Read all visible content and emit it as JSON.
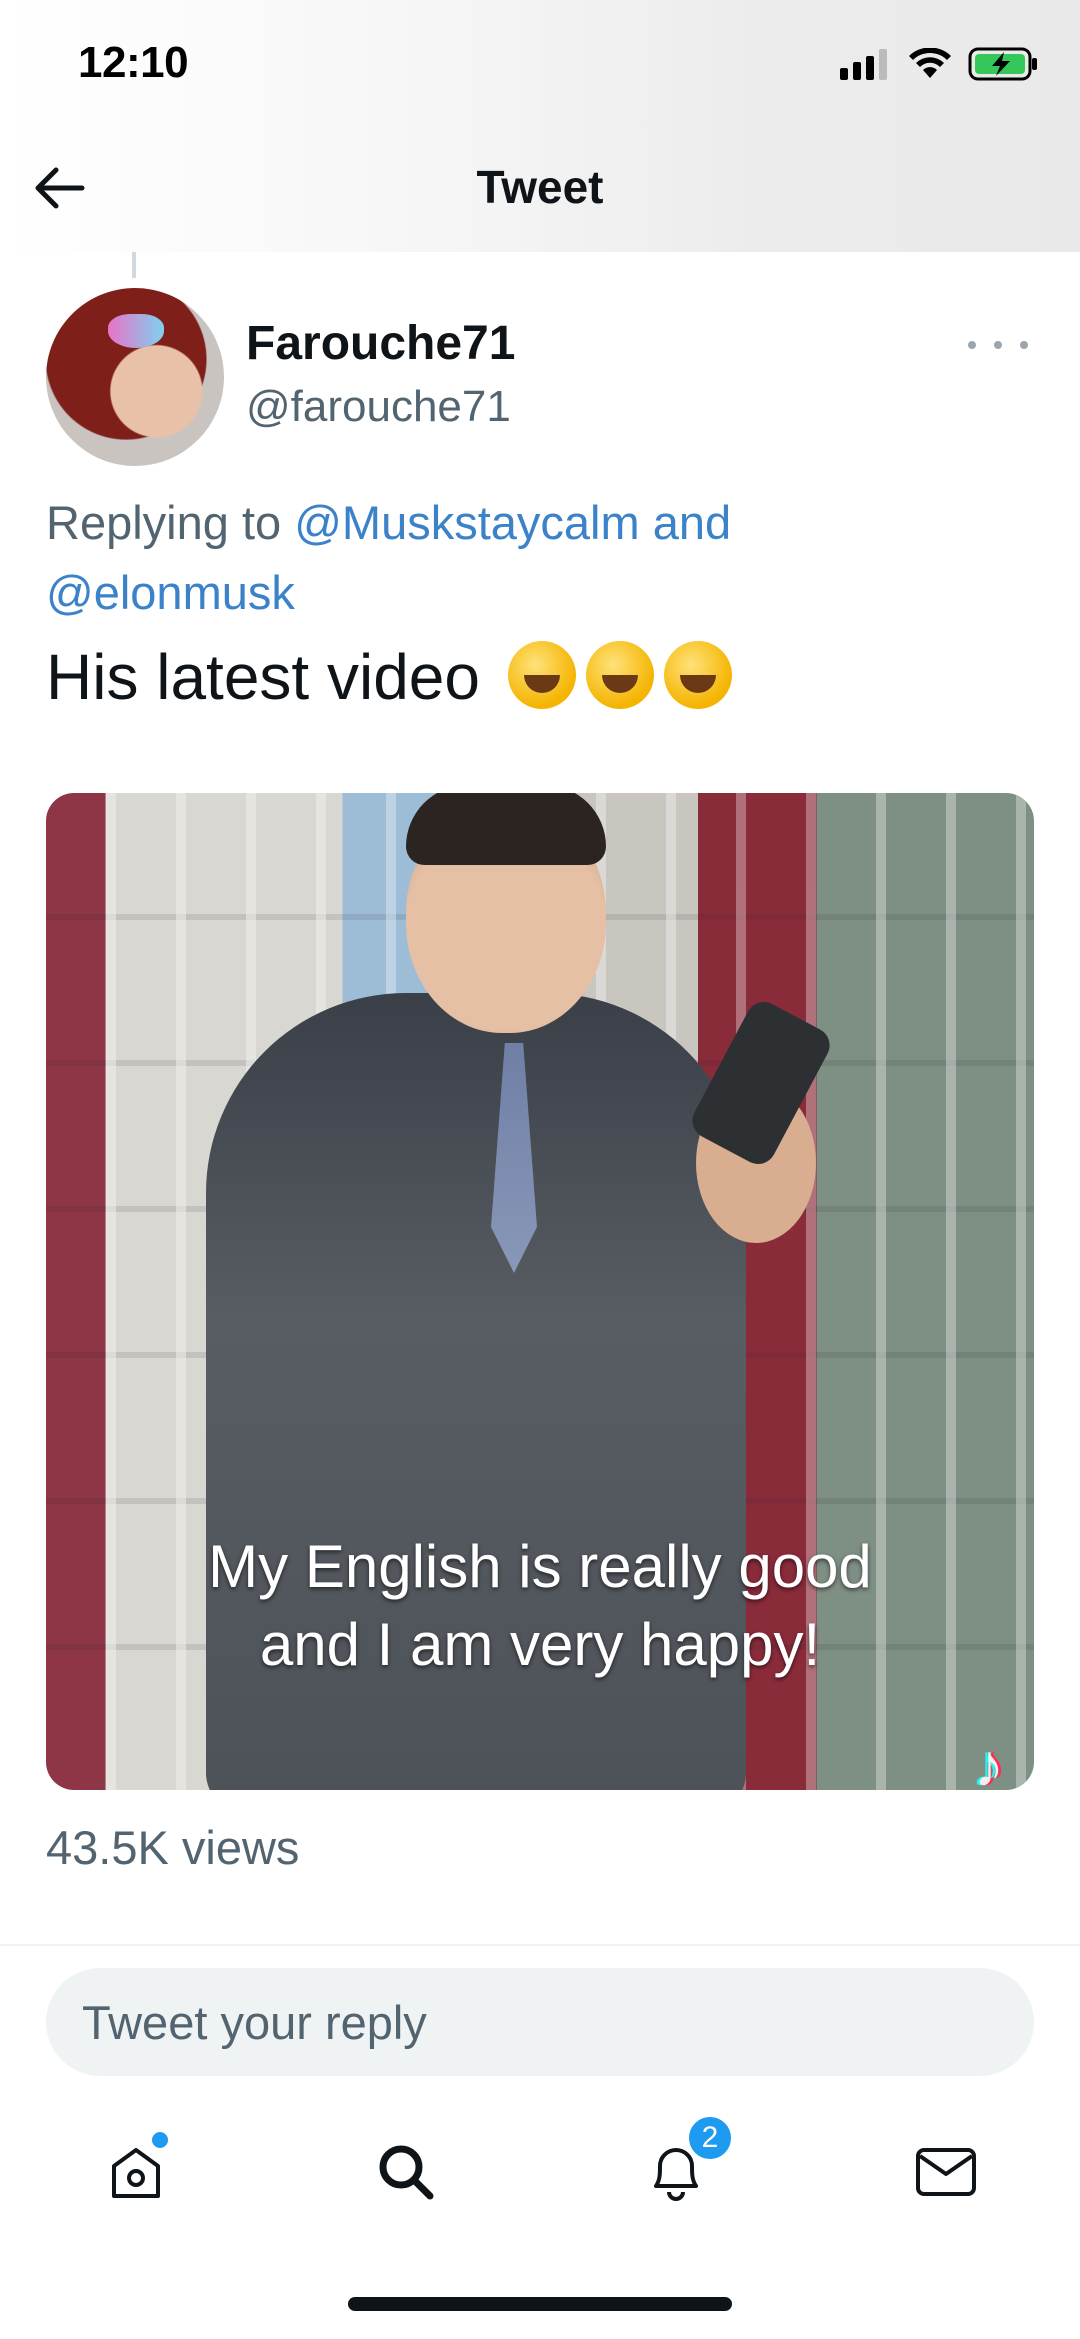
{
  "status_bar": {
    "time": "12:10",
    "icons": [
      "cellular-signal-icon",
      "wifi-icon",
      "battery-charging-icon"
    ]
  },
  "header": {
    "title": "Tweet",
    "back_icon": "arrow-left-icon"
  },
  "tweet": {
    "author": {
      "display_name": "Farouche71",
      "handle": "@farouche71"
    },
    "more_icon": "more-horizontal-icon",
    "replying": {
      "prefix": "Replying to ",
      "mention1": "@Muskstaycalm",
      "joiner": " and",
      "mention2": "@elonmusk"
    },
    "text": "His latest video",
    "emojis": [
      "rolling-on-floor-laughing",
      "rolling-on-floor-laughing",
      "rolling-on-floor-laughing"
    ],
    "media": {
      "caption_line1": "My English is really good",
      "caption_line2": "and I am very happy!"
    },
    "views": "43.5K views"
  },
  "reply_box": {
    "placeholder": "Tweet your reply"
  },
  "tabbar": {
    "items": [
      {
        "name": "home",
        "icon": "home-icon",
        "has_dot": true
      },
      {
        "name": "search",
        "icon": "search-icon"
      },
      {
        "name": "notifications",
        "icon": "bell-icon",
        "badge": "2"
      },
      {
        "name": "messages",
        "icon": "mail-icon"
      }
    ]
  },
  "colors": {
    "accent": "#1d9bf0",
    "secondary_text": "#536471",
    "primary_text": "#0f1419"
  }
}
